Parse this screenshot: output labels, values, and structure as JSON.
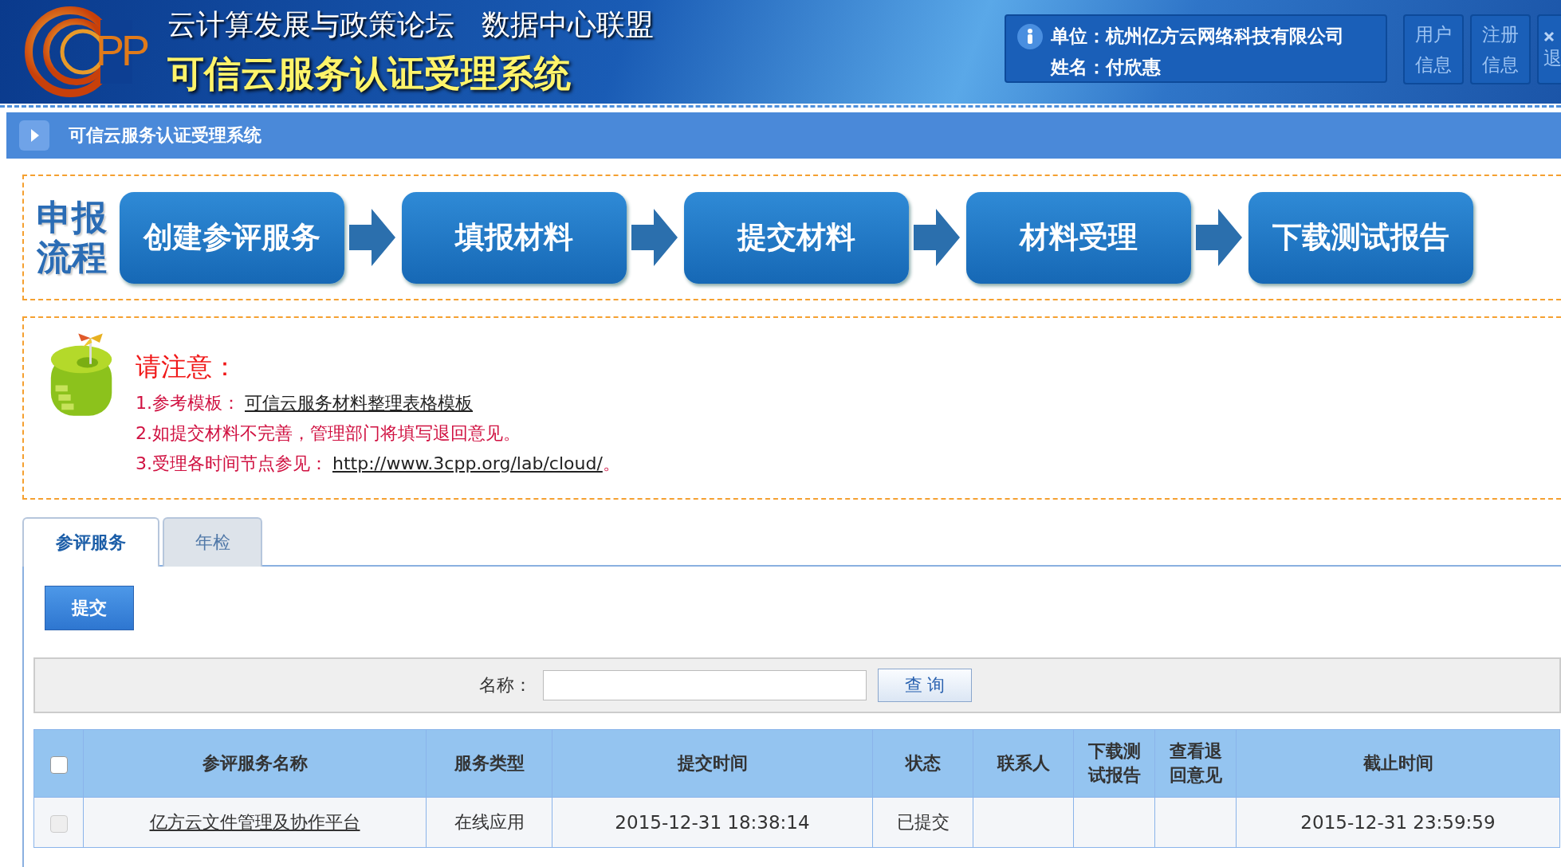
{
  "header": {
    "logo_text": "PP",
    "org_titles": [
      "云计算发展与政策论坛",
      "数据中心联盟"
    ],
    "system_title": "可信云服务认证受理系统",
    "user_info": {
      "unit_label": "单位：",
      "unit": "杭州亿方云网络科技有限公司",
      "name_label": "姓名：",
      "name": "付欣惠"
    },
    "buttons": [
      {
        "kind": "text",
        "label": "用户信息"
      },
      {
        "kind": "text",
        "label": "注册信息"
      },
      {
        "kind": "exit",
        "label": "退"
      }
    ]
  },
  "breadcrumb": "可信云服务认证受理系统",
  "flow": {
    "label": "申报流程",
    "steps": [
      "创建参评服务",
      "填报材料",
      "提交材料",
      "材料受理",
      "下载测试报告"
    ]
  },
  "notice": {
    "title": "请注意：",
    "items": [
      {
        "number": "1.",
        "text": "参考模板：",
        "link": "可信云服务材料整理表格模板"
      },
      {
        "number": "2.",
        "text": "如提交材料不完善，管理部门将填写退回意见。"
      },
      {
        "number": "3.",
        "text": "受理各时间节点参见：",
        "link": "http://www.3cpp.org/lab/cloud/",
        "suffix": "。"
      }
    ]
  },
  "tabs": [
    {
      "label": "参评服务",
      "selected": true
    },
    {
      "label": "年检",
      "selected": false
    }
  ],
  "submit_button": "提交",
  "search": {
    "label": "名称：",
    "button": "查 询"
  },
  "table": {
    "header_checked": false,
    "columns": [
      "参评服务名称",
      "服务类型",
      "提交时间",
      "状态",
      "联系人",
      "下载测试报告",
      "查看退回意见",
      "截止时间"
    ],
    "rows": [
      {
        "checked": false,
        "disabled": true,
        "name": "亿方云文件管理及协作平台",
        "service_type": "在线应用",
        "submit_time": "2015-12-31 18:38:14",
        "status": "已提交",
        "deadline": "2015-12-31 23:59:59"
      }
    ]
  }
}
